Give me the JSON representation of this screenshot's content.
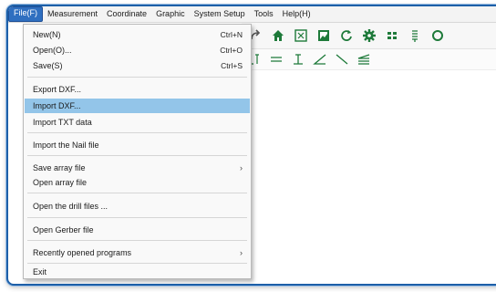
{
  "menubar": {
    "items": [
      "File(F)",
      "Measurement",
      "Coordinate",
      "Graphic",
      "System Setup",
      "Tools",
      "Help(H)"
    ]
  },
  "file_menu": {
    "items": [
      {
        "label": "New(N)",
        "shortcut": "Ctrl+N"
      },
      {
        "label": "Open(O)...",
        "shortcut": "Ctrl+O"
      },
      {
        "label": "Save(S)",
        "shortcut": "Ctrl+S"
      },
      {
        "label": "Export DXF..."
      },
      {
        "label": "Import DXF...",
        "highlighted": true
      },
      {
        "label": "Import TXT data"
      },
      {
        "label": "Import the Nail file"
      },
      {
        "label": "Save array file",
        "submenu": "›"
      },
      {
        "label": "Open array file"
      },
      {
        "label": "Open the drill files ..."
      },
      {
        "label": "Open Gerber file"
      },
      {
        "label": "Recently opened programs",
        "submenu": "›"
      },
      {
        "label": "Exit"
      }
    ]
  },
  "toolbar_top": {
    "icons": [
      "redo-icon",
      "home-icon",
      "fit-view-icon",
      "image-icon",
      "refresh-icon",
      "settings-gear-icon",
      "grid-icon",
      "list-icon",
      "circle-icon"
    ]
  },
  "toolbar_drawing": {
    "icons": [
      "line-tool-icon",
      "parallel-lines-icon",
      "perpendicular-icon",
      "angle-icon",
      "diagonal-line-icon",
      "multi-line-icon"
    ]
  },
  "colors": {
    "frame_border": "#1d5fa8",
    "menu_highlight": "#93c5e9",
    "active_menu": "#2f6fc0",
    "icon_green": "#1e7a3a"
  }
}
